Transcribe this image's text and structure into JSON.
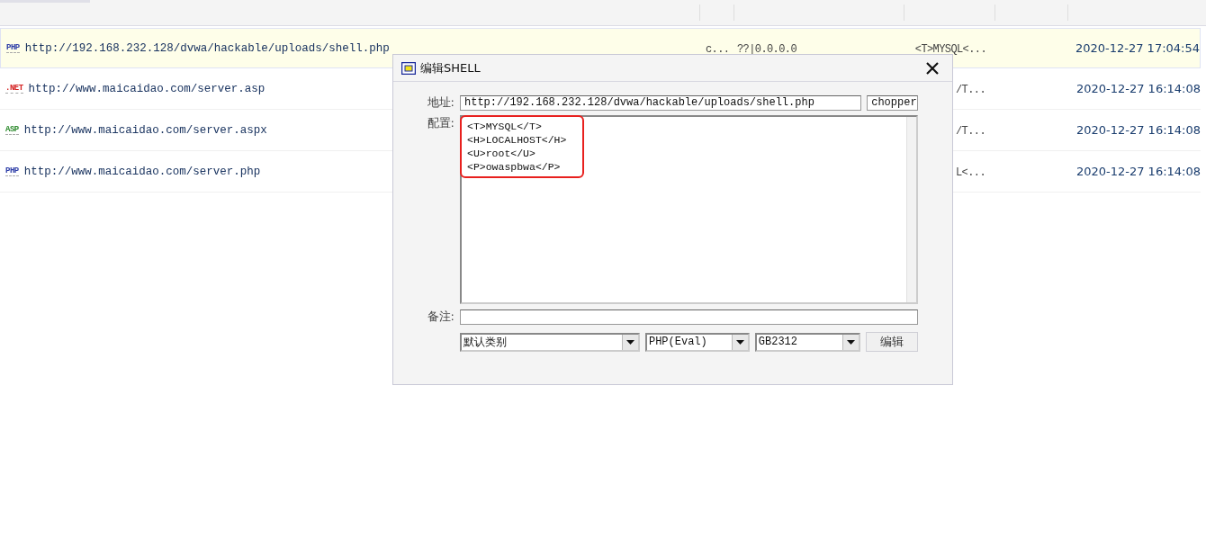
{
  "rows": [
    {
      "type_label": "PHP",
      "color": "#2f3fa8",
      "url": "http://192.168.232.128/dvwa/hackable/uploads/shell.php",
      "column_2": "c...",
      "column_3": "??|0.0.0.0",
      "column_4": "<T>MYSQL<...",
      "date": "2020-12-27 17:04:54",
      "selected": true
    },
    {
      "type_label": ".NET",
      "color": "#d42020",
      "url": "http://www.maicaidao.com/server.asp",
      "column_4": "/T...",
      "date": "2020-12-27 16:14:08",
      "selected": false
    },
    {
      "type_label": "ASP",
      "color": "#2e8b2e",
      "url": "http://www.maicaidao.com/server.aspx",
      "column_4": "/T...",
      "date": "2020-12-27 16:14:08",
      "selected": false
    },
    {
      "type_label": "PHP",
      "color": "#2f3fa8",
      "url": "http://www.maicaidao.com/server.php",
      "column_4": "L<...",
      "date": "2020-12-27 16:14:08",
      "selected": false
    }
  ],
  "dialog": {
    "title": "编辑SHELL",
    "address_label": "地址:",
    "address": "http://192.168.232.128/dvwa/hackable/uploads/shell.php",
    "password": "chopper",
    "config_label": "配置:",
    "config_lines": [
      "<T>MYSQL</T>",
      "<H>LOCALHOST</H>",
      "<U>root</U>",
      "<P>owaspbwa</P>"
    ],
    "remarks_label": "备注:",
    "category": "默认类别",
    "script_type": "PHP(Eval)",
    "encoding": "GB2312",
    "submit": "编辑"
  }
}
